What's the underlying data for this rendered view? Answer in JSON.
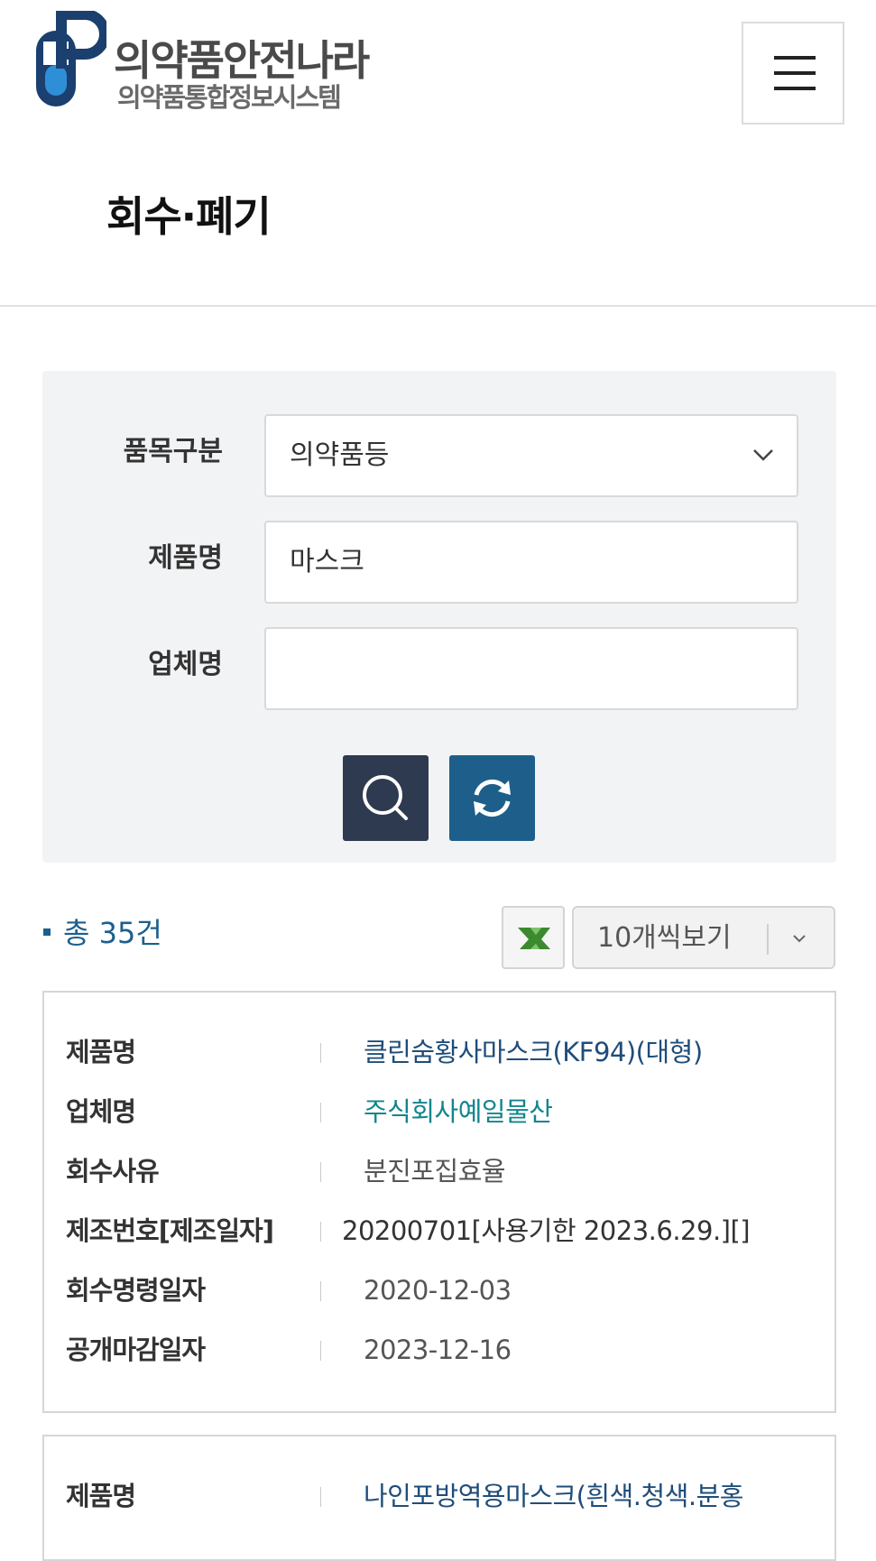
{
  "header": {
    "logo_title": "의약품안전나라",
    "logo_subtitle": "의약품통합정보시스템",
    "menu_icon": "hamburger-menu-icon"
  },
  "page_title": "회수·폐기",
  "search": {
    "category_label": "품목구분",
    "category_value": "의약품등",
    "product_label": "제품명",
    "product_value": "마스크",
    "company_label": "업체명",
    "company_value": "",
    "search_icon": "search-icon",
    "reset_icon": "refresh-icon"
  },
  "results": {
    "total_text": "총 35건",
    "excel_icon": "excel-download-icon",
    "page_size": "10개씩보기"
  },
  "colors": {
    "search_button": "#2e3a4f",
    "reset_button": "#1d5f8a",
    "accent": "#1b5f8f",
    "company_link": "#12858e"
  },
  "items": [
    {
      "product_label": "제품명",
      "product": "클린숨황사마스크(KF94)(대형)",
      "company_label": "업체명",
      "company": "주식회사예일물산",
      "reason_label": "회수사유",
      "reason": "분진포집효율",
      "lot_label": "제조번호[제조일자]",
      "lot": "20200701[사용기한 2023.6.29.][]",
      "order_date_label": "회수명령일자",
      "order_date": "2020-12-03",
      "close_date_label": "공개마감일자",
      "close_date": "2023-12-16"
    },
    {
      "product_label": "제품명",
      "product": "나인포방역용마스크(흰색.청색.분홍"
    }
  ]
}
